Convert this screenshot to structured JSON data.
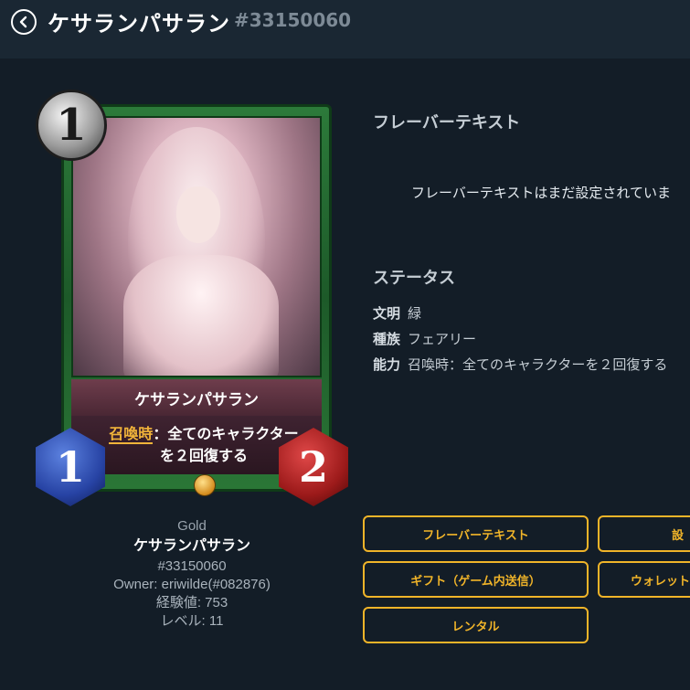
{
  "header": {
    "back_icon": "chevron-left-icon",
    "title": "ケサランパサラン",
    "card_id": "#33150060"
  },
  "card": {
    "cost": "1",
    "name": "ケサランパサラン",
    "ability_keyword": "召喚時",
    "ability_text_line1": "：全てのキャラクター",
    "ability_text_line2": "を２回復する",
    "attack": "1",
    "life": "2",
    "rarity_icon": "feather-gold-icon",
    "frame_color": "#2c7a3a"
  },
  "info": {
    "grade": "Gold",
    "name": "ケサランパサラン",
    "id": "#33150060",
    "owner": "Owner: eriwilde(#082876)",
    "exp": "経験値: 753",
    "level": "レベル: 11"
  },
  "flavor": {
    "title": "フレーバーテキスト",
    "text": "フレーバーテキストはまだ設定されていま"
  },
  "status": {
    "title": "ステータス",
    "rows": [
      {
        "key": "文明",
        "value": "緑"
      },
      {
        "key": "種族",
        "value": "フェアリー"
      },
      {
        "key": "能力",
        "value": "召喚時：全てのキャラクターを２回復する"
      }
    ]
  },
  "buttons": {
    "flavor": "フレーバーテキスト",
    "partial_right_top": "設",
    "gift": "ギフト（ゲーム内送信）",
    "wallet": "ウォレット",
    "rental": "レンタル"
  },
  "colors": {
    "accent": "#f0b429",
    "background": "#131d27",
    "header": "#1a2733"
  }
}
